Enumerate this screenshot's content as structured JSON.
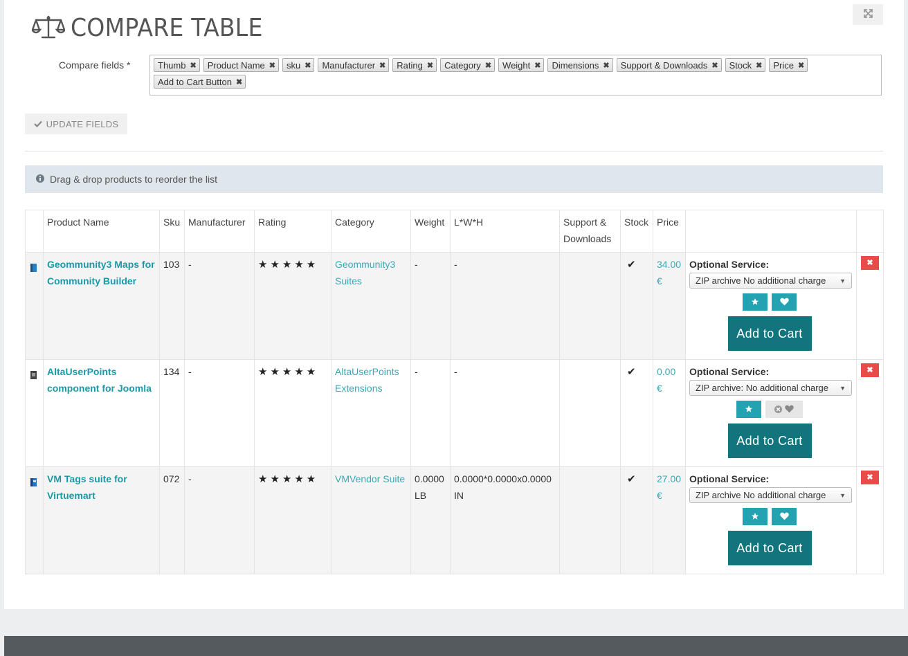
{
  "header": {
    "title": "COMPARE TABLE",
    "title_icon": "scale-icon",
    "expand_icon": "expand-icon"
  },
  "fields": {
    "label": "Compare fields *",
    "chips": [
      "Thumb",
      "Product Name",
      "sku",
      "Manufacturer",
      "Rating",
      "Category",
      "Weight",
      "Dimensions",
      "Support & Downloads",
      "Stock",
      "Price",
      "Add to Cart Button"
    ]
  },
  "update_button": {
    "label": "UPDATE FIELDS",
    "icon": "check-icon"
  },
  "info": {
    "text": "Drag & drop products to reorder the list",
    "icon": "info-icon"
  },
  "table": {
    "headers": {
      "thumb": "",
      "name": "Product Name",
      "sku": "Sku",
      "manufacturer": "Manufacturer",
      "rating": "Rating",
      "category": "Category",
      "weight": "Weight",
      "dimensions": "L*W*H",
      "support": "Support & Downloads",
      "stock": "Stock",
      "price": "Price",
      "cart": "",
      "remove": ""
    },
    "rows": [
      {
        "name": "Geommunity3 Maps for Community Builder",
        "sku": "103",
        "manufacturer": "-",
        "rating": "★★★★★",
        "rating_value": 5,
        "category": "Geommunity3 Suites",
        "weight": "-",
        "dimensions": "-",
        "support": "",
        "stock": "✔",
        "price": "34.00 €",
        "optional_label": "Optional Service:",
        "optional_value": "ZIP archive No additional charge",
        "favorite_state": "heart",
        "cart_label": "Add to Cart",
        "thumb_color": "#2a7fc0"
      },
      {
        "name": "AltaUserPoints component for Joomla",
        "sku": "134",
        "manufacturer": "-",
        "rating": "★★★★★",
        "rating_value": 5,
        "category": "AltaUserPoints Extensions",
        "weight": "-",
        "dimensions": "-",
        "support": "",
        "stock": "✔",
        "price": "0.00 €",
        "optional_label": "Optional Service:",
        "optional_value": "ZIP archive: No additional charge",
        "favorite_state": "remove-heart",
        "cart_label": "Add to Cart",
        "thumb_color": "#444444"
      },
      {
        "name": "VM Tags suite for Virtuemart",
        "sku": "072",
        "manufacturer": "-",
        "rating": "★★★★★",
        "rating_value": 5,
        "category": "VMVendor Suite",
        "weight": "0.0000 LB",
        "dimensions": "0.0000*0.0000x0.0000 IN",
        "support": "",
        "stock": "✔",
        "price": "27.00 €",
        "optional_label": "Optional Service:",
        "optional_value": "ZIP archive No additional charge",
        "favorite_state": "heart",
        "cart_label": "Add to Cart",
        "thumb_color": "#2a6fc0"
      }
    ]
  },
  "colors": {
    "accent": "#23a3b2",
    "cart": "#12757d",
    "delete": "#e94a4a",
    "link": "#3aa8b6"
  }
}
